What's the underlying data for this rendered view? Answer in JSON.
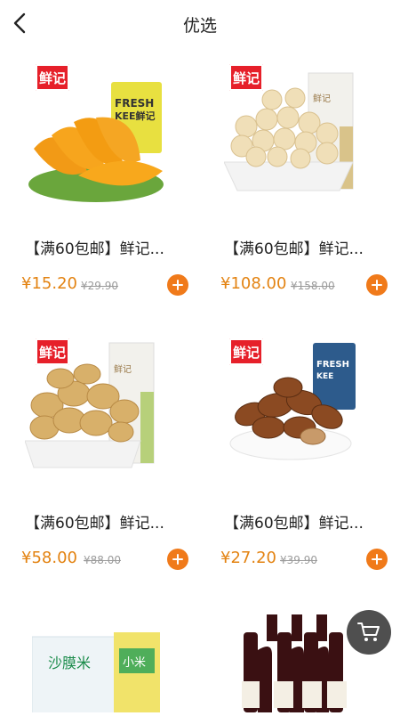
{
  "header": {
    "title": "优选"
  },
  "products": [
    {
      "tag": "鲜记",
      "name": "【满60包邮】鲜记...",
      "price": "¥15.20",
      "orig": "¥29.90",
      "image": "dried-mango"
    },
    {
      "tag": "鲜记",
      "name": "【满60包邮】鲜记...",
      "price": "¥108.00",
      "orig": "¥158.00",
      "image": "macadamia-nuts"
    },
    {
      "tag": "鲜记",
      "name": "【满60包邮】鲜记...",
      "price": "¥58.00",
      "orig": "¥88.00",
      "image": "walnuts"
    },
    {
      "tag": "鲜记",
      "name": "【满60包邮】鲜记...",
      "price": "¥27.20",
      "orig": "¥39.90",
      "image": "pecans"
    },
    {
      "image": "millet-rice-box",
      "box_text": "沙膜米",
      "label_text": "小米"
    },
    {
      "image": "red-wine-bottles"
    }
  ],
  "colors": {
    "price": "#e38312",
    "add_button": "#f07a1a",
    "tag_bg": "#e6202a"
  },
  "icons": {
    "back": "chevron-left-icon",
    "add": "plus-icon",
    "cart": "shopping-cart-icon"
  }
}
